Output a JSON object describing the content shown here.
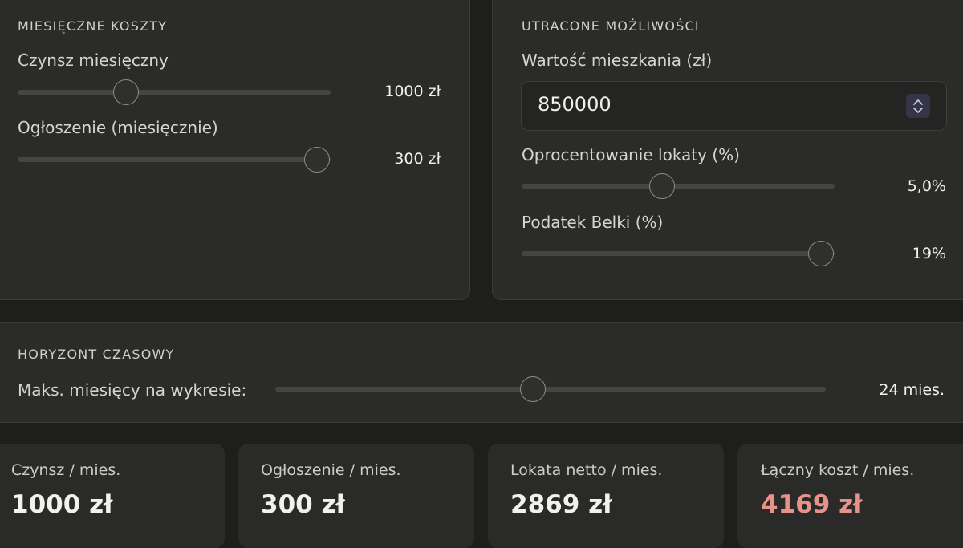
{
  "monthly_costs": {
    "title": "MIESIĘCZNE KOSZTY",
    "rent": {
      "label": "Czynsz miesięczny",
      "value": "1000 zł",
      "fraction": 0.35
    },
    "ad": {
      "label": "Ogłoszenie (miesięcznie)",
      "value": "300 zł",
      "fraction": 1.0
    }
  },
  "lost_opportunities": {
    "title": "UTRACONE MOŻLIWOŚCI",
    "property_value": {
      "label": "Wartość mieszkania (zł)",
      "value": "850000"
    },
    "interest": {
      "label": "Oprocentowanie lokaty (%)",
      "value": "5,0%",
      "fraction": 0.45
    },
    "tax": {
      "label": "Podatek Belki (%)",
      "value": "19%",
      "fraction": 0.95
    }
  },
  "time_horizon": {
    "title": "HORYZONT CZASOWY",
    "max_months": {
      "label": "Maks. miesięcy na wykresie:",
      "value": "24 mies.",
      "fraction": 0.47
    }
  },
  "stats": [
    {
      "label": "Czynsz / mies.",
      "value": "1000 zł"
    },
    {
      "label": "Ogłoszenie / mies.",
      "value": "300 zł"
    },
    {
      "label": "Lokata netto / mies.",
      "value": "2869 zł"
    },
    {
      "label": "Łączny koszt / mies.",
      "value": "4169 zł",
      "color": "#e8938a"
    }
  ],
  "icons": {
    "spinner": "chevron-up-down-icon"
  }
}
